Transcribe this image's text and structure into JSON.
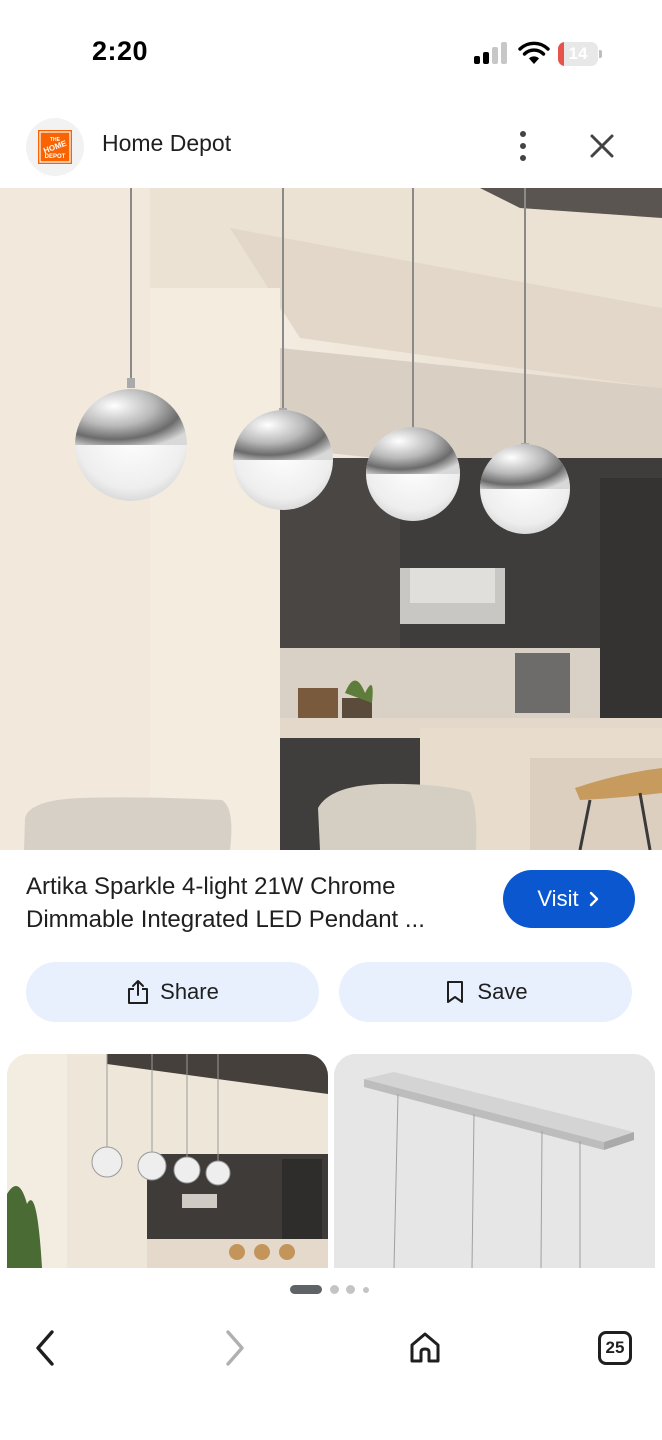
{
  "status_bar": {
    "time": "2:20",
    "battery_level": "14",
    "icons": [
      "signal-icon",
      "wifi-icon",
      "battery-icon"
    ]
  },
  "header": {
    "site_name": "Home Depot",
    "logo_text": "THE HOME DEPOT",
    "icons": [
      "more-vert-icon",
      "close-icon"
    ]
  },
  "product": {
    "title_line1": "Artika Sparkle 4-light 21W Chrome",
    "title_line2": "Dimmable Integrated LED Pendant ...",
    "visit_label": "Visit"
  },
  "actions": {
    "share_label": "Share",
    "save_label": "Save"
  },
  "pager": {
    "total": 4,
    "active": 1
  },
  "bottom_nav": {
    "tab_count": "25",
    "icons": [
      "back-icon",
      "forward-icon",
      "home-icon",
      "tabs-icon"
    ]
  },
  "colors": {
    "accent": "#0b57d0",
    "chip_bg": "#e8f0fe",
    "battery_low": "#e5534b",
    "brand_orange": "#f96302"
  }
}
